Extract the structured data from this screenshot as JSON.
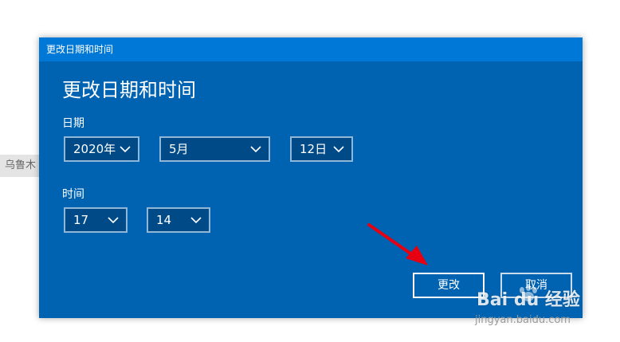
{
  "background": {
    "partial_text": "乌鲁木"
  },
  "dialog": {
    "window_title": "更改日期和时间",
    "heading": "更改日期和时间",
    "date_section": {
      "label": "日期",
      "year": "2020年",
      "month": "5月",
      "day": "12日"
    },
    "time_section": {
      "label": "时间",
      "hour": "17",
      "minute": "14"
    },
    "buttons": {
      "change": "更改",
      "cancel": "取消"
    }
  },
  "watermark": {
    "brand": "Bai du 经验",
    "url": "jingyan.baidu.com"
  },
  "colors": {
    "dialog_bg": "#0063b1",
    "titlebar_bg": "#0078d7",
    "annotation_arrow": "#e60012"
  }
}
